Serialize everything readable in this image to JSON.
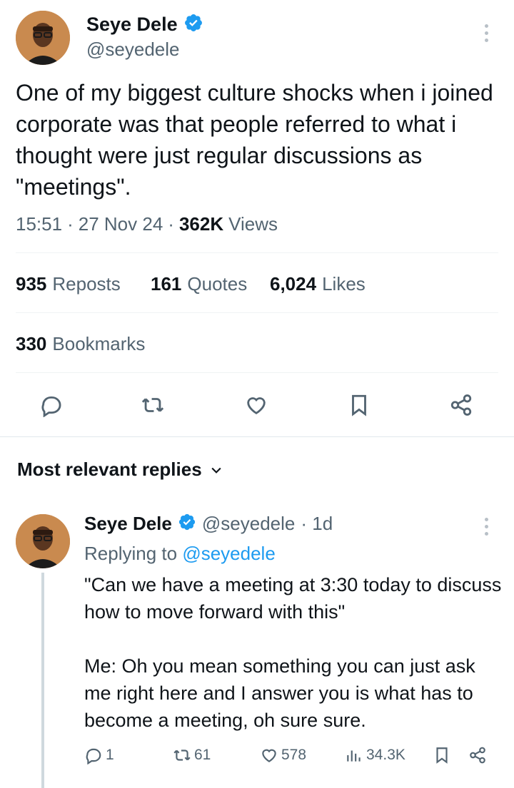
{
  "tweet": {
    "author_name": "Seye Dele",
    "author_handle": "@seyedele",
    "text": "One of my biggest culture shocks when i joined corporate was that people referred to what i thought were just regular discussions as \"meetings\".",
    "time": "15:51",
    "date": "27 Nov 24",
    "views_count": "362K",
    "views_label": "Views",
    "separator": "·"
  },
  "stats": {
    "reposts_count": "935",
    "reposts_label": "Reposts",
    "quotes_count": "161",
    "quotes_label": "Quotes",
    "likes_count": "6,024",
    "likes_label": "Likes",
    "bookmarks_count": "330",
    "bookmarks_label": "Bookmarks"
  },
  "actions": [
    "reply-icon",
    "repost-icon",
    "like-icon",
    "bookmark-icon",
    "share-icon"
  ],
  "replies_section": {
    "title": "Most relevant replies"
  },
  "reply": {
    "author_name": "Seye Dele",
    "author_handle": "@seyedele",
    "age": "· 1d",
    "replying_prefix": "Replying to",
    "replying_handle": "@seyedele",
    "text": "\"Can we have a meeting at 3:30 today to discuss how to move forward with this\"\n\nMe: Oh you mean something you can just ask me right here and I answer you is what has to become a meeting, oh sure sure.",
    "replies": "1",
    "reposts": "61",
    "likes": "578",
    "views": "34.3K"
  },
  "colors": {
    "accent": "#1d9bf0",
    "text": "#0f1419",
    "secondary": "#536471"
  }
}
